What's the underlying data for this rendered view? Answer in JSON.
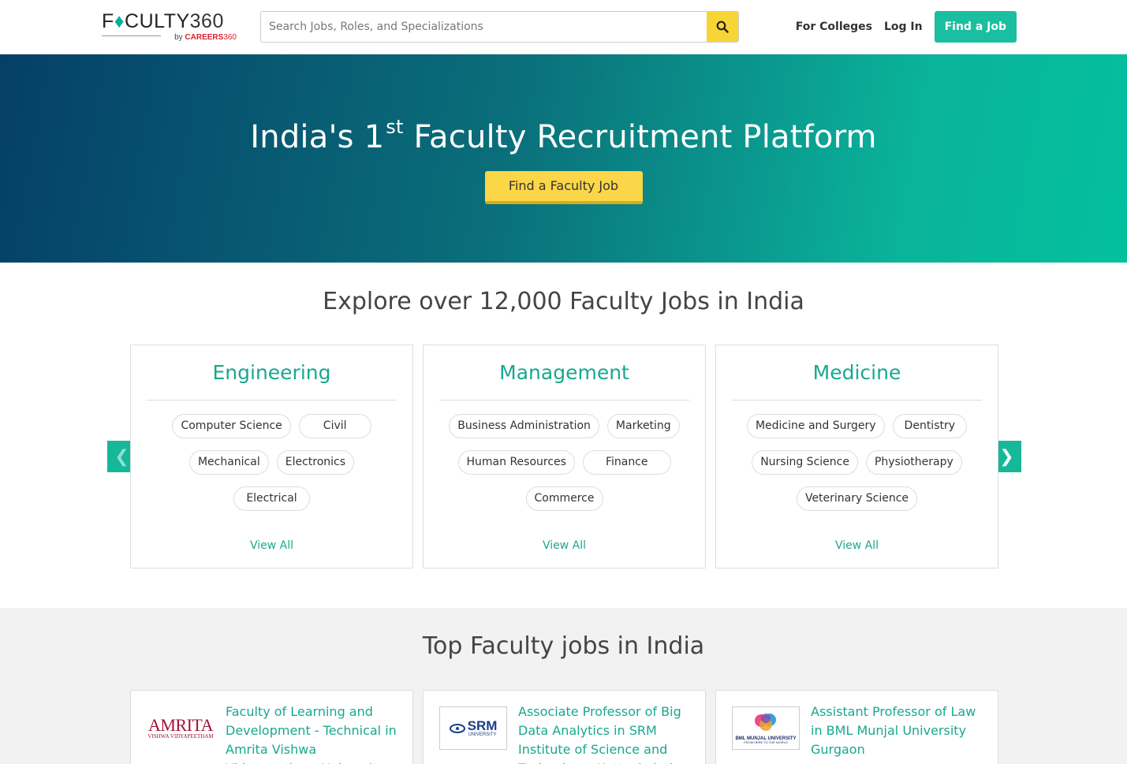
{
  "header": {
    "logo_main_a": "F",
    "logo_main_b": "CULTY",
    "logo_main_num": "360",
    "logo_sub_by": "by",
    "logo_sub_brand": "CAREERS",
    "logo_sub_num": "360",
    "search_placeholder": "Search Jobs, Roles, and Specializations",
    "search_icon": "search-icon",
    "nav": {
      "for_colleges": "For Colleges",
      "login": "Log In",
      "find_job": "Find a Job"
    }
  },
  "hero": {
    "title_a": "India's 1",
    "title_sup": "st",
    "title_b": " Faculty Recruitment Platform",
    "cta": "Find a Faculty Job"
  },
  "explore": {
    "heading": "Explore over 12,000 Faculty Jobs in India",
    "prev_arrow": "❮",
    "next_arrow": "❯",
    "cards": [
      {
        "title": "Engineering",
        "chips": [
          "Computer Science",
          "Civil",
          "Mechanical",
          "Electronics",
          "Electrical"
        ],
        "view_all": "View All"
      },
      {
        "title": "Management",
        "chips": [
          "Business Administration",
          "Marketing",
          "Human Resources",
          "Finance",
          "Commerce"
        ],
        "view_all": "View All"
      },
      {
        "title": "Medicine",
        "chips": [
          "Medicine and Surgery",
          "Dentistry",
          "Nursing Science",
          "Physiotherapy",
          "Veterinary Science"
        ],
        "view_all": "View All"
      }
    ]
  },
  "top_jobs": {
    "heading": "Top Faculty jobs in India",
    "jobs": [
      {
        "logo_text": "AMRITA",
        "logo_sub": "VISHWA VIDYAPEETHAM",
        "title": "Faculty of Learning and Development - Technical in Amrita Vishwa Vidyapeetham University"
      },
      {
        "logo_text": "SRM",
        "logo_sub": "UNIVERSITY",
        "title": "Associate Professor of Big Data Analytics in SRM Institute of Science and Technology, Kattankulathur"
      },
      {
        "logo_text": "BML MUNJAL UNIVERSITY",
        "logo_sub": "FROM HERE TO THE WORLD",
        "title": "Assistant Professor of Law in BML Munjal University Gurgaon"
      }
    ]
  },
  "colors": {
    "accent": "#19bfa0",
    "accent_text": "#19a88f",
    "cta_yellow": "#fbd648",
    "search_button": "#f7d535",
    "hero_gradient_start": "#053f68",
    "hero_gradient_end": "#03c09d"
  }
}
